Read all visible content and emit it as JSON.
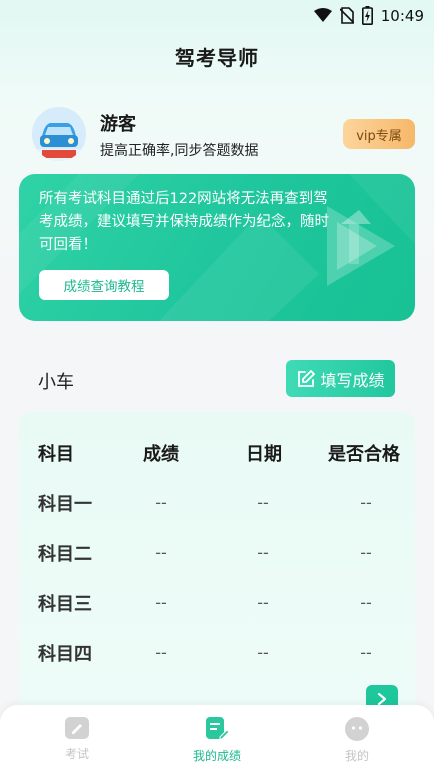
{
  "status_bar": {
    "time": "10:49",
    "icons": [
      "wifi-icon",
      "no-sim-icon",
      "battery-charging-icon"
    ]
  },
  "app_title": "驾考导师",
  "profile": {
    "name": "游客",
    "subtitle": "提高正确率,同步答题数据",
    "vip_label": "vip专属"
  },
  "banner": {
    "text": "所有考试科目通过后122网站将无法再查到驾考成绩，建议填写并保持成绩作为纪念，随时可回看！",
    "button_label": "成绩查询教程"
  },
  "car_type": "小车",
  "fill_button_label": "填写成绩",
  "table": {
    "headers": [
      "科目",
      "成绩",
      "日期",
      "是否合格"
    ],
    "rows": [
      {
        "subject": "科目一",
        "score": "--",
        "date": "--",
        "pass": "--"
      },
      {
        "subject": "科目二",
        "score": "--",
        "date": "--",
        "pass": "--"
      },
      {
        "subject": "科目三",
        "score": "--",
        "date": "--",
        "pass": "--"
      },
      {
        "subject": "科目四",
        "score": "--",
        "date": "--",
        "pass": "--"
      }
    ]
  },
  "bottom_nav": [
    {
      "label": "考试",
      "icon": "pencil-icon",
      "active": false
    },
    {
      "label": "我的成绩",
      "icon": "score-sheet-icon",
      "active": true
    },
    {
      "label": "我的",
      "icon": "profile-face-icon",
      "active": false
    }
  ],
  "colors": {
    "accent": "#1ec79c",
    "vip": "#f6b86a",
    "nav_active": "#1db98f",
    "nav_inactive": "#c4c4c4"
  }
}
